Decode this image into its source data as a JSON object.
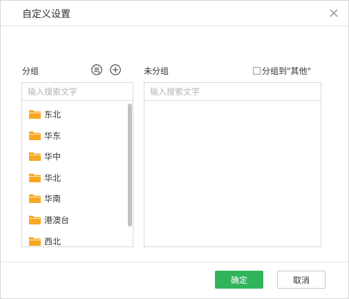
{
  "dialog": {
    "title": "自定义设置"
  },
  "grouped": {
    "label": "分组",
    "search_placeholder": "输入搜索文字",
    "items": [
      {
        "label": "东北"
      },
      {
        "label": "华东"
      },
      {
        "label": "华中"
      },
      {
        "label": "华北"
      },
      {
        "label": "华南"
      },
      {
        "label": "港澳台"
      },
      {
        "label": "西北"
      }
    ]
  },
  "ungrouped": {
    "label": "未分组",
    "search_placeholder": "输入搜索文字",
    "checkbox_label": "分组到\"其他\"",
    "checkbox_checked": false
  },
  "footer": {
    "ok_label": "确定",
    "cancel_label": "取消"
  },
  "colors": {
    "primary_button": "#2fb45a",
    "folder": "#f7a823"
  }
}
